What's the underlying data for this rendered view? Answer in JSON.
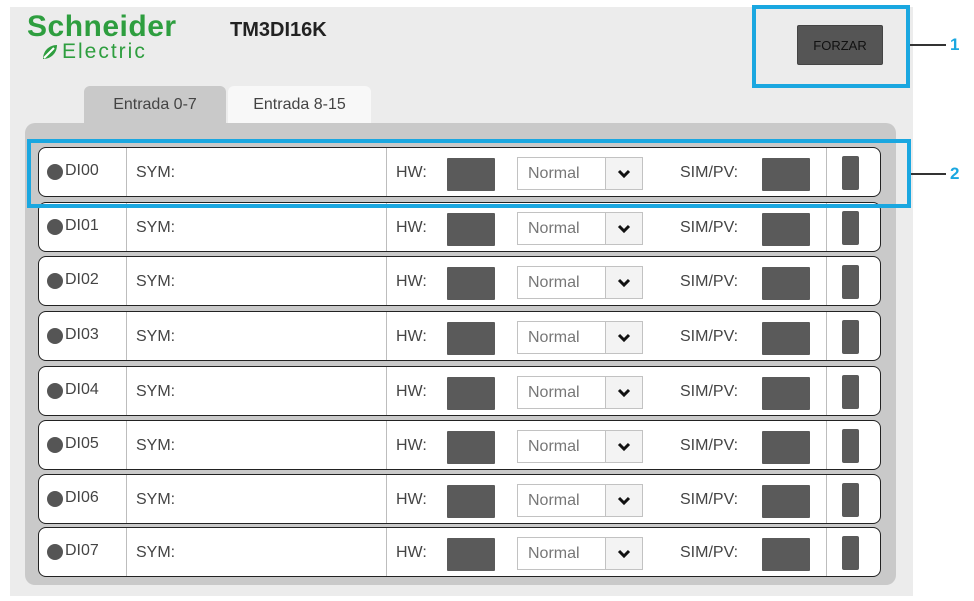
{
  "brand": {
    "name": "Schneider",
    "sub": "Electric"
  },
  "module_title": "TM3DI16K",
  "force_button_label": "FORZAR",
  "callouts": [
    "1",
    "2"
  ],
  "tabs": [
    {
      "label": "Entrada 0-7",
      "active": true
    },
    {
      "label": "Entrada 8-15",
      "active": false
    }
  ],
  "rows": [
    {
      "channel": "DI00",
      "sym_label": "SYM:",
      "hw_label": "HW:",
      "mode": "Normal",
      "sim_label": "SIM/PV:"
    },
    {
      "channel": "DI01",
      "sym_label": "SYM:",
      "hw_label": "HW:",
      "mode": "Normal",
      "sim_label": "SIM/PV:"
    },
    {
      "channel": "DI02",
      "sym_label": "SYM:",
      "hw_label": "HW:",
      "mode": "Normal",
      "sim_label": "SIM/PV:"
    },
    {
      "channel": "DI03",
      "sym_label": "SYM:",
      "hw_label": "HW:",
      "mode": "Normal",
      "sim_label": "SIM/PV:"
    },
    {
      "channel": "DI04",
      "sym_label": "SYM:",
      "hw_label": "HW:",
      "mode": "Normal",
      "sim_label": "SIM/PV:"
    },
    {
      "channel": "DI05",
      "sym_label": "SYM:",
      "hw_label": "HW:",
      "mode": "Normal",
      "sim_label": "SIM/PV:"
    },
    {
      "channel": "DI06",
      "sym_label": "SYM:",
      "hw_label": "HW:",
      "mode": "Normal",
      "sim_label": "SIM/PV:"
    },
    {
      "channel": "DI07",
      "sym_label": "SYM:",
      "hw_label": "HW:",
      "mode": "Normal",
      "sim_label": "SIM/PV:"
    }
  ],
  "colors": {
    "brand_green": "#2e9e3f",
    "callout_blue": "#1aa7e0",
    "indicator_gray": "#5a5a5a"
  },
  "icons": {
    "dropdown": "chevron-down-icon",
    "status": "led-icon",
    "brand": "leaf-icon"
  }
}
